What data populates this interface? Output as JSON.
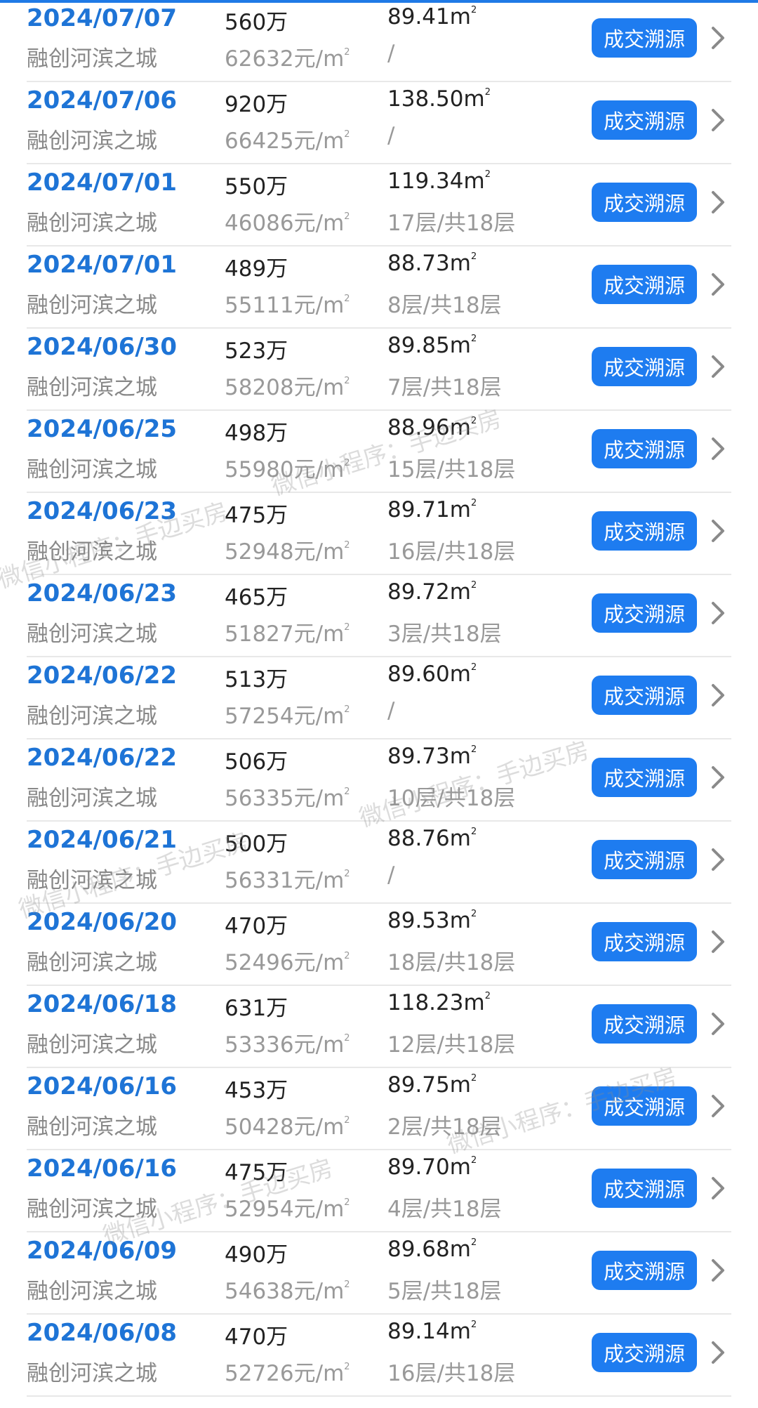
{
  "area_unit": "m",
  "price_unit": "元/m",
  "watermark": {
    "text": "微信小程序：手边买房",
    "part_brand": "手边买房"
  },
  "colors": {
    "date": "#1e74d6",
    "button": "#1e7cf0",
    "muted": "#999999"
  },
  "rows": [
    {
      "date": "2024/07/07",
      "project": "融创河滨之城",
      "price": "560万",
      "unit_price": "62632",
      "area": "89.41",
      "floor": "/",
      "action": "成交溯源"
    },
    {
      "date": "2024/07/06",
      "project": "融创河滨之城",
      "price": "920万",
      "unit_price": "66425",
      "area": "138.50",
      "floor": "/",
      "action": "成交溯源"
    },
    {
      "date": "2024/07/01",
      "project": "融创河滨之城",
      "price": "550万",
      "unit_price": "46086",
      "area": "119.34",
      "floor": "17层/共18层",
      "action": "成交溯源"
    },
    {
      "date": "2024/07/01",
      "project": "融创河滨之城",
      "price": "489万",
      "unit_price": "55111",
      "area": "88.73",
      "floor": "8层/共18层",
      "action": "成交溯源"
    },
    {
      "date": "2024/06/30",
      "project": "融创河滨之城",
      "price": "523万",
      "unit_price": "58208",
      "area": "89.85",
      "floor": "7层/共18层",
      "action": "成交溯源"
    },
    {
      "date": "2024/06/25",
      "project": "融创河滨之城",
      "price": "498万",
      "unit_price": "55980",
      "area": "88.96",
      "floor": "15层/共18层",
      "action": "成交溯源"
    },
    {
      "date": "2024/06/23",
      "project": "融创河滨之城",
      "price": "475万",
      "unit_price": "52948",
      "area": "89.71",
      "floor": "16层/共18层",
      "action": "成交溯源"
    },
    {
      "date": "2024/06/23",
      "project": "融创河滨之城",
      "price": "465万",
      "unit_price": "51827",
      "area": "89.72",
      "floor": "3层/共18层",
      "action": "成交溯源"
    },
    {
      "date": "2024/06/22",
      "project": "融创河滨之城",
      "price": "513万",
      "unit_price": "57254",
      "area": "89.60",
      "floor": "/",
      "action": "成交溯源"
    },
    {
      "date": "2024/06/22",
      "project": "融创河滨之城",
      "price": "506万",
      "unit_price": "56335",
      "area": "89.73",
      "floor": "10层/共18层",
      "action": "成交溯源"
    },
    {
      "date": "2024/06/21",
      "project": "融创河滨之城",
      "price": "500万",
      "unit_price": "56331",
      "area": "88.76",
      "floor": "/",
      "action": "成交溯源"
    },
    {
      "date": "2024/06/20",
      "project": "融创河滨之城",
      "price": "470万",
      "unit_price": "52496",
      "area": "89.53",
      "floor": "18层/共18层",
      "action": "成交溯源"
    },
    {
      "date": "2024/06/18",
      "project": "融创河滨之城",
      "price": "631万",
      "unit_price": "53336",
      "area": "118.23",
      "floor": "12层/共18层",
      "action": "成交溯源"
    },
    {
      "date": "2024/06/16",
      "project": "融创河滨之城",
      "price": "453万",
      "unit_price": "50428",
      "area": "89.75",
      "floor": "2层/共18层",
      "action": "成交溯源"
    },
    {
      "date": "2024/06/16",
      "project": "融创河滨之城",
      "price": "475万",
      "unit_price": "52954",
      "area": "89.70",
      "floor": "4层/共18层",
      "action": "成交溯源"
    },
    {
      "date": "2024/06/09",
      "project": "融创河滨之城",
      "price": "490万",
      "unit_price": "54638",
      "area": "89.68",
      "floor": "5层/共18层",
      "action": "成交溯源"
    },
    {
      "date": "2024/06/08",
      "project": "融创河滨之城",
      "price": "470万",
      "unit_price": "52726",
      "area": "89.14",
      "floor": "16层/共18层",
      "action": "成交溯源"
    }
  ]
}
